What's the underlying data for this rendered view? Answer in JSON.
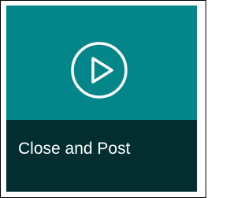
{
  "tile": {
    "label": "Close and Post",
    "icon": "play-circle-icon",
    "colors": {
      "tile_background": "#03868a",
      "caption_background": "#022e30",
      "icon_stroke": "#ffffff",
      "caption_text": "#ffffff",
      "frame_border": "#000000"
    }
  }
}
